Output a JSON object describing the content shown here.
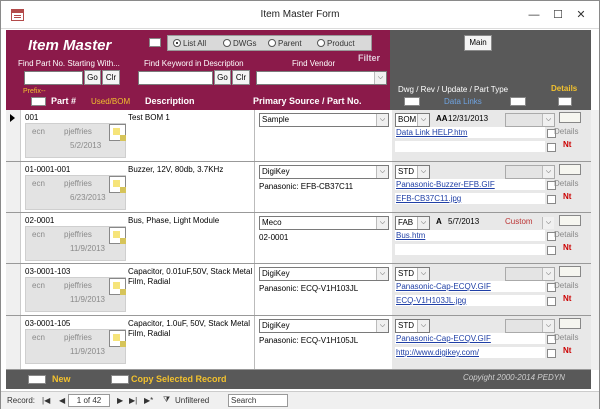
{
  "window": {
    "title": "Item Master Form",
    "min": "—",
    "max": "☐",
    "close": "✕"
  },
  "header": {
    "app_title": "Item Master",
    "filter_options": [
      "List All",
      "DWGs",
      "Parent",
      "Product"
    ],
    "filter_label": "Filter",
    "search_part_label": "Find Part No. Starting With...",
    "search_desc_label": "Find Keyword in Description",
    "vendor_label": "Find Vendor",
    "go": "Go",
    "clr": "Clr",
    "main_button": "Main",
    "dwg_label": "Dwg / Rev / Update / Part Type",
    "details_label": "Details",
    "prefix_label": "Prefix--",
    "data_links_label": "Data Links",
    "col_part": "Part #",
    "col_used": "Used/BOM",
    "col_desc": "Description",
    "col_source": "Primary Source / Part No."
  },
  "records": [
    {
      "part": "001",
      "ecn": "ecn",
      "user": "pjeffries",
      "date": "5/2/2013",
      "desc": "Test BOM 1",
      "source": "Sample",
      "source_part": "",
      "type": "BOM",
      "aa": "AA",
      "update": "12/31/2013",
      "custom": "",
      "links": [
        "Data Link HELP.htm",
        ""
      ],
      "details": "Details",
      "nt": "Nt"
    },
    {
      "part": "01-0001-001",
      "ecn": "ecn",
      "user": "pjeffries",
      "date": "6/23/2013",
      "desc": "Buzzer, 12V, 80db, 3.7KHz",
      "source": "DigiKey",
      "source_part": "Panasonic:  EFB-CB37C11",
      "type": "STD",
      "aa": "",
      "update": "",
      "custom": "",
      "links": [
        "Panasonic-Buzzer-EFB.GIF",
        "EFB-CB37C11.jpg"
      ],
      "details": "Details",
      "nt": "Nt"
    },
    {
      "part": "02-0001",
      "ecn": "ecn",
      "user": "pjeffries",
      "date": "11/9/2013",
      "desc": "Bus, Phase, Light Module",
      "source": "Meco",
      "source_part": "02-0001",
      "type": "FAB",
      "aa": "A",
      "update": "5/7/2013",
      "custom": "Custom",
      "links": [
        "Bus.htm",
        ""
      ],
      "details": "Details",
      "nt": "Nt"
    },
    {
      "part": "03-0001-103",
      "ecn": "ecn",
      "user": "pjeffries",
      "date": "11/9/2013",
      "desc": "Capacitor, 0.01uF,50V, Stack Metal Film, Radial",
      "source": "DigiKey",
      "source_part": "Panasonic: ECQ-V1H103JL",
      "type": "STD",
      "aa": "",
      "update": "",
      "custom": "",
      "links": [
        "Panasonic-Cap-ECQV.GIF",
        "ECQ-V1H103JL.jpg"
      ],
      "details": "Details",
      "nt": "Nt"
    },
    {
      "part": "03-0001-105",
      "ecn": "ecn",
      "user": "pjeffries",
      "date": "11/9/2013",
      "desc": "Capacitor, 1.0uF, 50V, Stack Metal Film, Radial",
      "source": "DigiKey",
      "source_part": "Panasonic: ECQ-V1H105JL",
      "type": "STD",
      "aa": "",
      "update": "",
      "custom": "",
      "links": [
        "Panasonic-Cap-ECQV.GIF",
        "http://www.digikey.com/"
      ],
      "details": "Details",
      "nt": "Nt"
    }
  ],
  "footer": {
    "new": "New",
    "copy": "Copy Selected Record",
    "copyright": "Copyight 2000-2014  PEDYN"
  },
  "nav": {
    "record_label": "Record:",
    "first": "|◀",
    "prev": "◀",
    "position": "1 of 42",
    "next": "▶",
    "last": "▶|",
    "new": "▶*",
    "filter_icon": "⧩",
    "filter_state": "Unfiltered",
    "search": "Search"
  }
}
